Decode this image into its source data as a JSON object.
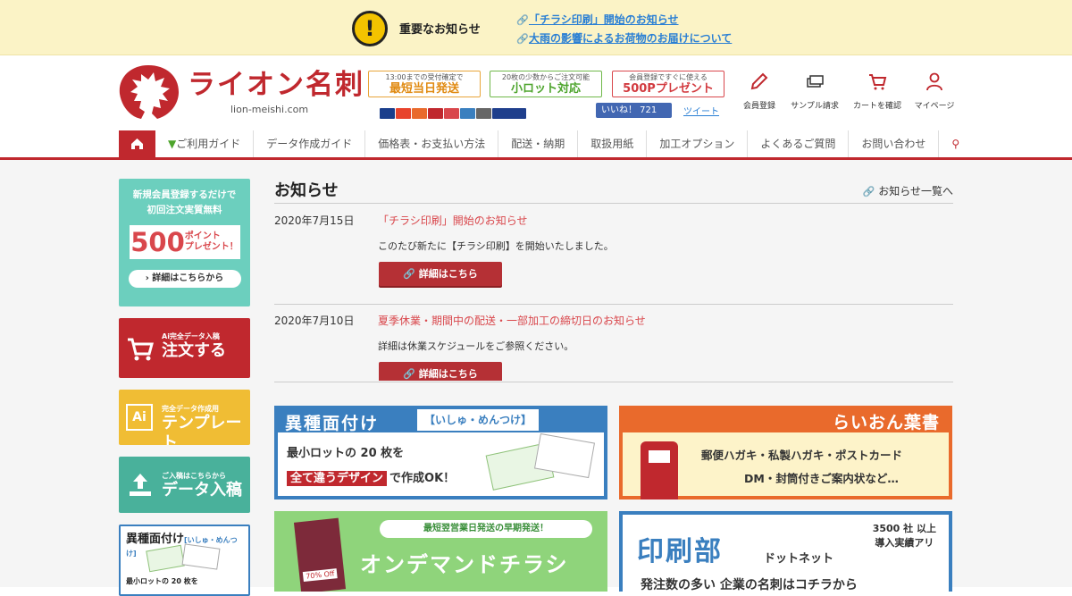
{
  "notice": {
    "title": "重要なお知らせ",
    "links": [
      "「チラシ印刷」開始のお知らせ",
      "大雨の影響によるお荷物のお届けについて"
    ]
  },
  "header": {
    "logo_text": "ライオン名刺",
    "logo_url": "lion-meishi.com",
    "badges": [
      {
        "small": "13:00までの受付確定で",
        "big": "最短当日発送"
      },
      {
        "small": "20枚の少数からご注文可能",
        "big": "小ロット対応"
      },
      {
        "small": "会員登録ですぐに使える",
        "big": "500Pプレゼント"
      }
    ],
    "like_label": "いいね！ 721",
    "tweet_label": "ツイート",
    "icons": [
      {
        "label": "会員登録",
        "icon": "pen-icon"
      },
      {
        "label": "サンプル請求",
        "icon": "cards-icon"
      },
      {
        "label": "カートを確認",
        "icon": "cart-icon"
      },
      {
        "label": "マイページ",
        "icon": "user-icon"
      }
    ]
  },
  "nav": {
    "items": [
      "ご利用ガイド",
      "データ作成ガイド",
      "価格表・お支払い方法",
      "配送・納期",
      "取扱用紙",
      "加工オプション",
      "よくあるご質問",
      "お問い合わせ"
    ]
  },
  "sidebar": {
    "member": {
      "line1": "新規会員登録するだけで",
      "line2": "初回注文実質無料",
      "num": "500",
      "points": "ポイント",
      "present": "プレゼント！",
      "detail": "詳細はこちらから"
    },
    "order": {
      "small": "Ai完全データ入稿",
      "big": "注文する"
    },
    "template": {
      "small": "完全データ作成用",
      "big": "テンプレート"
    },
    "upload": {
      "small": "ご入稿はこちらから",
      "big": "データ入稿"
    },
    "isyu": {
      "title": "異種面付け",
      "kana": "[いしゅ・めんつけ]",
      "foot": "最小ロットの 20 枚を"
    }
  },
  "news": {
    "title": "お知らせ",
    "more": "お知らせ一覧へ",
    "items": [
      {
        "date": "2020年7月15日",
        "title": "「チラシ印刷」開始のお知らせ",
        "body": "このたび新たに【チラシ印刷】を開始いたしました。",
        "button": "詳細はこちら"
      },
      {
        "date": "2020年7月10日",
        "title": "夏季休業・期間中の配送・一部加工の締切日のお知らせ",
        "body": "詳細は休業スケジュールをご参照ください。",
        "button": "詳細はこちら"
      }
    ]
  },
  "banners": {
    "isyu": {
      "title": "異種面付け",
      "kana": "【いしゅ・めんつけ】",
      "line1": "最小ロットの 20 枚を",
      "line2_em": "全て違うデザイン",
      "line2_rest": "で作成OK！"
    },
    "hagaki": {
      "title": "らいおん葉書",
      "line1": "郵便ハガキ・私製ハガキ・ポストカード",
      "line2": "DM・封筒付きご案内状など…"
    },
    "flyer": {
      "small": "最短翌営業日発送の早期発送！",
      "big": "オンデマンドチラシ",
      "sale": "70% Off"
    },
    "insatsubu": {
      "title": "印刷部",
      "dotnet": "ドットネット",
      "record_1": "3500 社 以上",
      "record_2": "導入実績アリ",
      "foot": "発注数の多い 企業の名刺はコチラから"
    }
  }
}
